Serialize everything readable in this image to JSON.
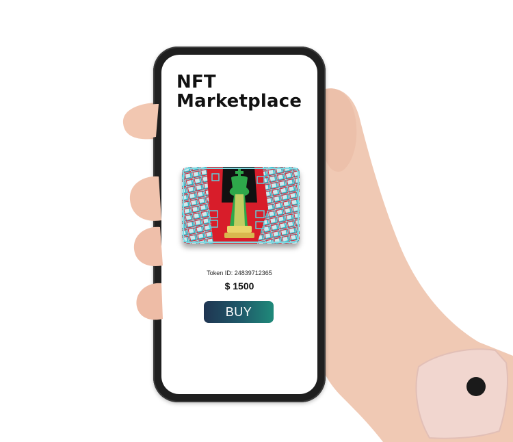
{
  "app": {
    "title_line1": "NFT",
    "title_line2": "Marketplace"
  },
  "nft": {
    "image_name": "chess-king-nft-image",
    "token_id_text": "Token ID: 24839712365",
    "price_text": "$ 1500"
  },
  "actions": {
    "buy_label": "BUY"
  },
  "colors": {
    "buy_gradient_start": "#1f3552",
    "buy_gradient_end": "#1f8a7a",
    "phone_body": "#1f1f1f",
    "skin": "#f0c9b4",
    "wristband": "#f1d6cf"
  }
}
